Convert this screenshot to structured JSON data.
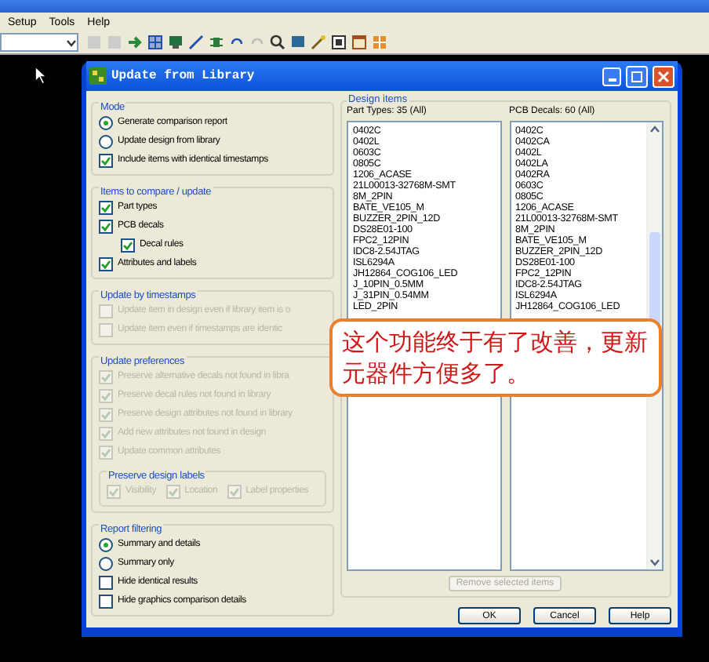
{
  "menu": [
    {
      "label": "Setup"
    },
    {
      "label": "Tools"
    },
    {
      "label": "Help"
    }
  ],
  "dialog": {
    "title": "Update from Library",
    "left_groups": [
      {
        "title": "Mode",
        "disabled": false,
        "items": [
          {
            "kind": "radio",
            "label": "Generate comparison report",
            "selected": true
          },
          {
            "kind": "radio",
            "label": "Update design from library",
            "selected": false
          },
          {
            "kind": "check",
            "label": "Include items with identical timestamps",
            "checked": true
          }
        ]
      },
      {
        "title": "Items to compare / update",
        "disabled": false,
        "items": [
          {
            "kind": "check",
            "label": "Part types",
            "checked": true
          },
          {
            "kind": "check",
            "label": "PCB decals",
            "checked": true,
            "children": [
              {
                "kind": "check",
                "label": "Decal rules",
                "checked": true
              }
            ]
          },
          {
            "kind": "check",
            "label": "Attributes and labels",
            "checked": true
          }
        ]
      },
      {
        "title": "Update by timestamps",
        "disabled": true,
        "items": [
          {
            "kind": "check",
            "label": "Update item in design even if library item is o",
            "checked": false
          },
          {
            "kind": "check",
            "label": "Update item even if timestamps are identic",
            "checked": false
          }
        ]
      },
      {
        "title": "Update preferences",
        "disabled": true,
        "items": [
          {
            "kind": "check",
            "label": "Preserve alternative decals not found in libra",
            "checked": true
          },
          {
            "kind": "check",
            "label": "Preserve decal rules not found in library",
            "checked": true
          },
          {
            "kind": "check",
            "label": "Preserve design attributes not found in library",
            "checked": true
          },
          {
            "kind": "check",
            "label": "Add new attributes not found in design",
            "checked": true
          },
          {
            "kind": "check",
            "label": "Update common attributes",
            "checked": true
          },
          {
            "kind": "group",
            "title": "Preserve design labels",
            "items": [
              {
                "kind": "check",
                "label": "Visibility",
                "checked": true
              },
              {
                "kind": "check",
                "label": "Location",
                "checked": true
              },
              {
                "kind": "check",
                "label": "Label properties",
                "checked": true
              }
            ]
          }
        ]
      },
      {
        "title": "Report filtering",
        "disabled": false,
        "items": [
          {
            "kind": "radio",
            "label": "Summary and details",
            "selected": true
          },
          {
            "kind": "radio",
            "label": "Summary only",
            "selected": false
          },
          {
            "kind": "check",
            "label": "Hide identical results",
            "checked": false
          },
          {
            "kind": "check",
            "label": "Hide graphics comparison details",
            "checked": false
          }
        ]
      }
    ],
    "design_items": {
      "title": "Design items",
      "lists": [
        {
          "header": "Part Types: 35 (All)",
          "items": [
            "0402C",
            "0402L",
            "0603C",
            "0805C",
            "1206_ACASE",
            "21L00013-32768M-SMT",
            "8M_2PIN",
            "BATE_VE105_M",
            "BUZZER_2PIN_12D",
            "DS28E01-100",
            "FPC2_12PIN",
            "IDC8-2.54JTAG",
            "ISL6294A",
            "JH12864_COG106_LED",
            "J_10PIN_0.5MM",
            "J_31PIN_0.54MM",
            "LED_2PIN"
          ]
        },
        {
          "header": "PCB Decals: 60 (All)",
          "items": [
            "0402C",
            "0402CA",
            "0402L",
            "0402LA",
            "0402RA",
            "0603C",
            "0805C",
            "1206_ACASE",
            "21L00013-32768M-SMT",
            "8M_2PIN",
            "BATE_VE105_M",
            "BUZZER_2PIN_12D",
            "DS28E01-100",
            "FPC2_12PIN",
            "IDC8-2.54JTAG",
            "ISL6294A",
            "JH12864_COG106_LED"
          ]
        }
      ],
      "remove_button": {
        "label": "Remove selected items",
        "disabled": true
      }
    },
    "buttons": [
      {
        "label": "OK"
      },
      {
        "label": "Cancel"
      },
      {
        "label": "Help"
      }
    ],
    "callout": {
      "text": "这个功能终于有了改善，更新元器件方便多了。"
    }
  }
}
